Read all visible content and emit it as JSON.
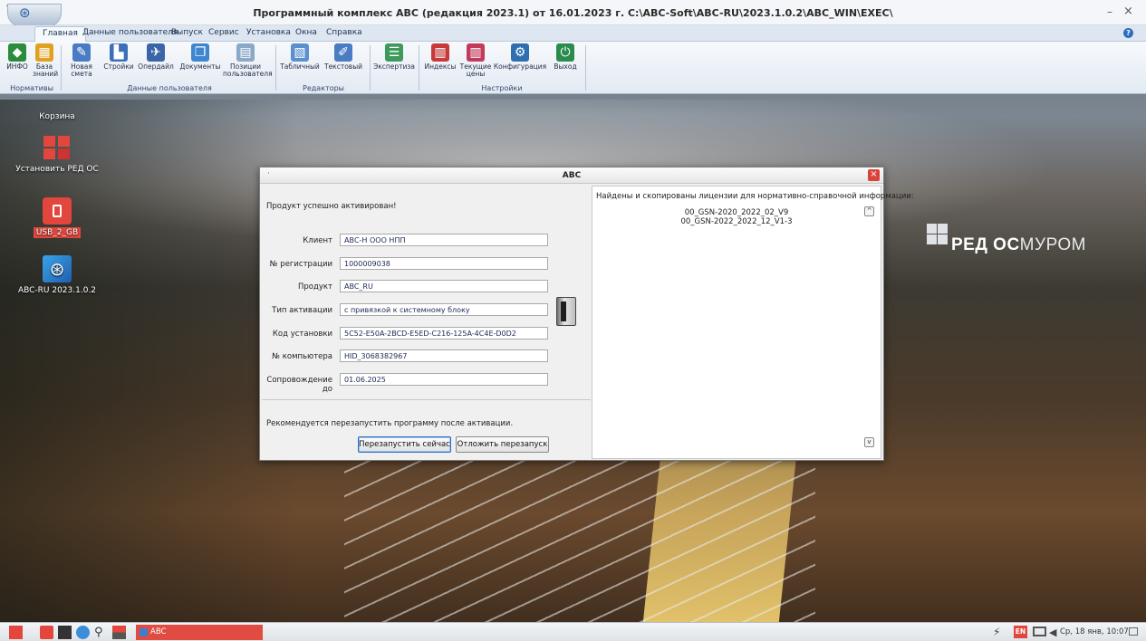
{
  "window": {
    "title": "Программный комплекс АВС (редакция 2023.1) от 16.01.2023 г.     C:\\ABC-Soft\\ABC-RU\\2023.1.0.2\\ABC_WIN\\EXEC\\",
    "minimize": "–",
    "close": "×",
    "dot": "·"
  },
  "menu": {
    "tabs": [
      "Главная",
      "Данные пользователя",
      "Выпуск",
      "Сервис",
      "Установка",
      "Окна",
      "Справка"
    ],
    "help": "?"
  },
  "ribbon": {
    "buttons": [
      {
        "label": "ИНФО",
        "icon": "info-icon",
        "color": "#2a8c3c"
      },
      {
        "label": "База знаний",
        "icon": "knowledge-base-icon",
        "color": "#e0a020"
      },
      {
        "label": "Новая смета",
        "icon": "new-estimate-icon",
        "color": "#4a7cc4"
      },
      {
        "label": "Стройки",
        "icon": "construction-icon",
        "color": "#3d6fb8"
      },
      {
        "label": "Опердайл",
        "icon": "operfile-icon",
        "color": "#3a66a8"
      },
      {
        "label": "Документы",
        "icon": "documents-icon",
        "color": "#3f86d0"
      },
      {
        "label": "Позиции пользователя",
        "icon": "user-positions-icon",
        "color": "#8aa8c8"
      },
      {
        "label": "Табличный",
        "icon": "table-editor-icon",
        "color": "#5a8fd0"
      },
      {
        "label": "Текстовый",
        "icon": "text-editor-icon",
        "color": "#4a7cc4"
      },
      {
        "label": "Экспертиза",
        "icon": "expertise-icon",
        "color": "#3c9a5a"
      },
      {
        "label": "Индексы",
        "icon": "indexes-icon",
        "color": "#c83a3a"
      },
      {
        "label": "Текущие цены",
        "icon": "current-prices-icon",
        "color": "#c43a5a"
      },
      {
        "label": "Конфигурация",
        "icon": "configuration-icon",
        "color": "#2f6fb0"
      },
      {
        "label": "Выход",
        "icon": "exit-icon",
        "color": "#2a8c4c"
      }
    ],
    "groups": [
      "Нормативы",
      "Данные пользователя",
      "Редакторы",
      "Настройки"
    ]
  },
  "desktop": {
    "icons": [
      {
        "label": "Корзина",
        "icon": "trash-icon"
      },
      {
        "label": "Установить РЕД ОС",
        "icon": "redos-install-icon"
      },
      {
        "label": "USB_2_GB",
        "icon": "usb-drive-icon"
      },
      {
        "label": "ABC-RU 2023.1.0.2",
        "icon": "abc-app-icon"
      }
    ],
    "logo": {
      "brand": "РЕД ОС",
      "suffix": "МУРОМ"
    }
  },
  "dialog": {
    "title": "АВС",
    "close": "×",
    "dot": "·",
    "success_message": "Продукт успешно активирован!",
    "fields": [
      {
        "label": "Клиент",
        "value": "АВС-Н ООО НПП"
      },
      {
        "label": "№ регистрации",
        "value": "1000009038"
      },
      {
        "label": "Продукт",
        "value": "ABC_RU"
      },
      {
        "label": "Тип активации",
        "value": "с привязкой к системному блоку"
      },
      {
        "label": "Код установки",
        "value": "5C52-E50A-2BCD-E5ED-C216-125A-4C4E-D0D2"
      },
      {
        "label": "№ компьютера",
        "value": "HID_3068382967"
      },
      {
        "label": "Сопровождение до",
        "value": "01.06.2025"
      }
    ],
    "restart_message": "Рекомендуется перезапустить программу после активации.",
    "restart_now": "Перезапустить сейчас",
    "postpone": "Отложить перезапуск",
    "licenses_header": "Найдены и скопированы лицензии для нормативно-справочной информации:",
    "licenses": [
      "00_GSN-2020_2022_02_V9",
      "00_GSN-2022_2022_12_V1-3"
    ],
    "scroll_up": "^",
    "scroll_down": "v"
  },
  "taskbar": {
    "task_label": "ABC",
    "language": "EN",
    "clock": "Ср, 18 янв, 10:07"
  }
}
